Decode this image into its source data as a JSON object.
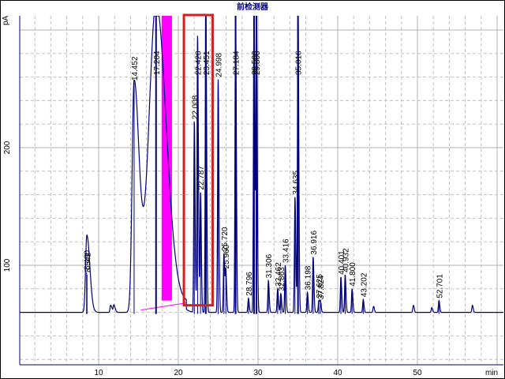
{
  "chart_data": {
    "type": "line",
    "title": "前检测器",
    "ylabel": "pA",
    "xlabel": "min",
    "xlim": [
      0,
      61
    ],
    "ylim": [
      15,
      302
    ],
    "x_ticks": [
      10,
      20,
      30,
      40,
      50
    ],
    "y_ticks": [
      100,
      200
    ],
    "grid": true,
    "baseline_pA": 60,
    "trace_color": "#000080",
    "fill_color": "#ff00ff",
    "highlight_color": "#d02020",
    "highlight_box": {
      "x_range_min": [
        20.7,
        24.3
      ],
      "y_range_pA": [
        66,
        310
      ]
    },
    "filled_band_min": [
      17.9,
      19.2
    ],
    "peaks": [
      {
        "rt": 8.49,
        "label": "8.490",
        "height": 94
      },
      {
        "rt": 8.542,
        "label": "8.542",
        "height": 92
      },
      {
        "rt": 14.452,
        "label": "14.452",
        "height": 255
      },
      {
        "rt": 17.204,
        "label": "17.204",
        "height": 320
      },
      {
        "rt": 22.008,
        "label": "22.008",
        "height": 222
      },
      {
        "rt": 22.42,
        "label": "22.420",
        "height": 295
      },
      {
        "rt": 22.787,
        "label": "22.787",
        "height": 162
      },
      {
        "rt": 23.451,
        "label": "23.451",
        "height": 320
      },
      {
        "rt": 24.998,
        "label": "24.998",
        "height": 258
      },
      {
        "rt": 25.72,
        "label": "25.720",
        "height": 110
      },
      {
        "rt": 25.96,
        "label": "25.960",
        "height": 95
      },
      {
        "rt": 27.184,
        "label": "27.184",
        "height": 320
      },
      {
        "rt": 28.796,
        "label": "28.796",
        "height": 72
      },
      {
        "rt": 29.5,
        "label": "29.500",
        "height": 320
      },
      {
        "rt": 29.8,
        "label": "29.800",
        "height": 320
      },
      {
        "rt": 31.306,
        "label": "31.306",
        "height": 87
      },
      {
        "rt": 32.462,
        "label": "32.462",
        "height": 80
      },
      {
        "rt": 32.863,
        "label": "32.863",
        "height": 76
      },
      {
        "rt": 33.416,
        "label": "33.416",
        "height": 100
      },
      {
        "rt": 34.635,
        "label": "34.635",
        "height": 158
      },
      {
        "rt": 35.016,
        "label": "35.016",
        "height": 320
      },
      {
        "rt": 36.198,
        "label": "36.198",
        "height": 77
      },
      {
        "rt": 36.916,
        "label": "36.916",
        "height": 107
      },
      {
        "rt": 37.625,
        "label": "37.625",
        "height": 70
      },
      {
        "rt": 37.824,
        "label": "37.824",
        "height": 69
      },
      {
        "rt": 40.401,
        "label": "40.401",
        "height": 90
      },
      {
        "rt": 40.932,
        "label": "40.932",
        "height": 92
      },
      {
        "rt": 41.8,
        "label": "41.800",
        "height": 80
      },
      {
        "rt": 43.202,
        "label": "43.202",
        "height": 71
      },
      {
        "rt": 52.701,
        "label": "52.701",
        "height": 70
      }
    ],
    "minor_peaks": [
      {
        "rt": 11.5,
        "height": 66
      },
      {
        "rt": 11.9,
        "height": 66
      },
      {
        "rt": 44.5,
        "height": 65
      },
      {
        "rt": 49.5,
        "height": 66
      },
      {
        "rt": 51.8,
        "height": 64
      },
      {
        "rt": 56.9,
        "height": 66
      }
    ]
  }
}
